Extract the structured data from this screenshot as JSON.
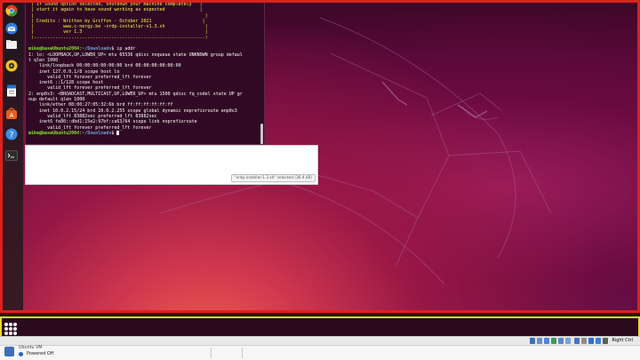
{
  "terminal": {
    "lines": [
      {
        "kind": "banner",
        "text": " | If Sound option selected, shutdown your machine completely   |"
      },
      {
        "kind": "banner",
        "text": " | start it again to have sound working as expected             |"
      },
      {
        "kind": "banner",
        "text": " |                                                                |"
      },
      {
        "kind": "banner",
        "text": " | Credits : Written by Griffon - October 2021                   |"
      },
      {
        "kind": "banner",
        "text": " |           www.c-nergy.be -xrdp-installer-v1.3.sh               |"
      },
      {
        "kind": "banner",
        "text": " |           ver 1.3                                              |"
      },
      {
        "kind": "banner",
        "text": " !----------------------------------------------------------------!"
      },
      {
        "kind": "blank",
        "text": ""
      },
      {
        "kind": "prompt",
        "user": "mike@baseUbuntu2004:",
        "path": "~/Downloads",
        "cmd": "$ ip addr"
      },
      {
        "kind": "out",
        "text": "1: lo: <LOOPBACK,UP,LOWER_UP> mtu 65536 qdisc noqueue state UNKNOWN group defaul"
      },
      {
        "kind": "out",
        "text": "t qlen 1000"
      },
      {
        "kind": "out",
        "text": "    link/loopback 00:00:00:00:00:00 brd 00:00:00:00:00:00"
      },
      {
        "kind": "out",
        "text": "    inet 127.0.0.1/8 scope host lo"
      },
      {
        "kind": "out",
        "text": "       valid_lft forever preferred_lft forever"
      },
      {
        "kind": "out",
        "text": "    inet6 ::1/128 scope host"
      },
      {
        "kind": "out",
        "text": "       valid_lft forever preferred_lft forever"
      },
      {
        "kind": "out",
        "text": "2: enp0s3: <BROADCAST,MULTICAST,UP,LOWER_UP> mtu 1500 qdisc fq_codel state UP gr"
      },
      {
        "kind": "out",
        "text": "oup default qlen 1000"
      },
      {
        "kind": "out",
        "text": "    link/ether 08:00:27:05:32:6b brd ff:ff:ff:ff:ff:ff"
      },
      {
        "kind": "out",
        "text": "    inet 10.0.2.15/24 brd 10.0.2.255 scope global dynamic noprefixroute enp0s3"
      },
      {
        "kind": "out",
        "text": "       valid_lft 83882sec preferred_lft 83882sec"
      },
      {
        "kind": "out",
        "text": "    inet6 fe80::dbd1:15e2:97bf:ca63/64 scope link noprefixroute"
      },
      {
        "kind": "out",
        "text": "       valid_lft forever preferred_lft forever"
      },
      {
        "kind": "prompt",
        "user": "mike@baseUbuntu2004:",
        "path": "~/Downloads",
        "cmd": "$ "
      }
    ]
  },
  "files": {
    "status": "\"xrdp-installer-1.3.sh\" selected (36.4 kB)"
  },
  "dock": {
    "items": [
      {
        "name": "chrome-icon",
        "color": "#e0401c"
      },
      {
        "name": "thunderbird-icon",
        "color": "#2f7ce0"
      },
      {
        "name": "files-icon",
        "color": "#f0f0f0"
      },
      {
        "name": "rhythmbox-icon",
        "color": "#f4c320"
      },
      {
        "name": "writer-icon",
        "color": "#1f6fd8"
      },
      {
        "name": "software-icon",
        "color": "#e85f1e"
      },
      {
        "name": "help-icon",
        "color": "#3a8de8"
      },
      {
        "name": "terminal-icon",
        "color": "#2c2c2c"
      }
    ]
  },
  "vbox": {
    "host_key": "Right Ctrl",
    "vm_name": "Ubuntu VM",
    "vm_state": "Powered Off"
  },
  "colors": {
    "highlight_red": "#e0201c",
    "highlight_yellow": "#e8dd1b",
    "terminal_bg": "#300a24"
  }
}
